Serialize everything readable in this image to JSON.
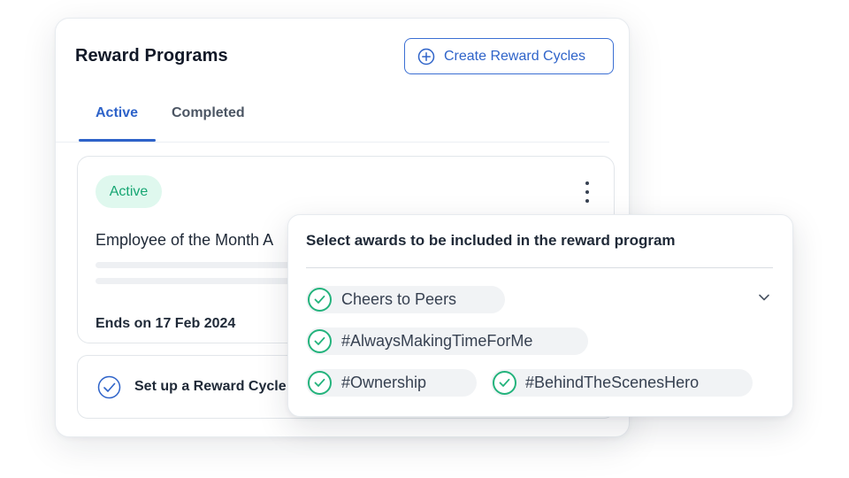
{
  "card": {
    "title": "Reward Programs",
    "create_button_label": "Create Reward Cycles",
    "tabs": [
      {
        "label": "Active",
        "selected": true
      },
      {
        "label": "Completed",
        "selected": false
      }
    ],
    "program": {
      "status": "Active",
      "title": "Employee of the Month A",
      "ends": "Ends on 17 Feb 2024"
    },
    "setup_label": "Set up a Reward Cycle"
  },
  "overlay": {
    "title": "Select awards to be included in the reward program",
    "awards": [
      {
        "label": "Cheers to Peers",
        "checked": true
      },
      {
        "label": "#AlwaysMakingTimeForMe",
        "checked": true
      },
      {
        "label": "#Ownership",
        "checked": true
      },
      {
        "label": "#BehindTheScenesHero",
        "checked": true
      }
    ]
  },
  "colors": {
    "accent": "#2e63c9",
    "success": "#23b37c",
    "success_bg": "#dff8ee"
  },
  "icons": [
    "plus-circle-icon",
    "kebab-menu-icon",
    "check-circle-icon",
    "chevron-down-icon"
  ]
}
